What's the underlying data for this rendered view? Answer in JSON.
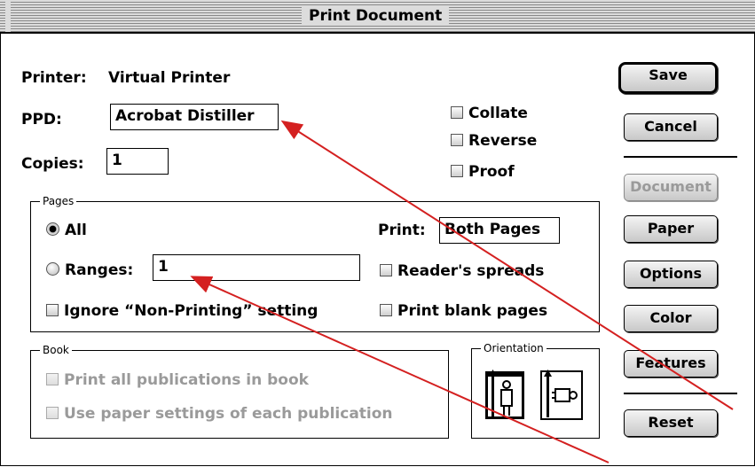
{
  "window": {
    "title": "Print Document"
  },
  "printer": {
    "label": "Printer:",
    "value": "Virtual Printer"
  },
  "ppd": {
    "label": "PPD:",
    "value": "Acrobat Distiller"
  },
  "copies": {
    "label": "Copies:",
    "value": "1"
  },
  "options": {
    "collate": "Collate",
    "reverse": "Reverse",
    "proof": "Proof"
  },
  "pages": {
    "title": "Pages",
    "all": "All",
    "ranges": "Ranges:",
    "ranges_value": "1",
    "print_label": "Print:",
    "print_value": "Both Pages",
    "readers_spreads": "Reader's spreads",
    "ignore_nonprinting": "Ignore “Non-Printing” setting",
    "print_blank": "Print blank pages"
  },
  "book": {
    "title": "Book",
    "print_all": "Print all publications in book",
    "use_paper": "Use paper settings of each publication"
  },
  "orientation": {
    "title": "Orientation"
  },
  "buttons": {
    "save": "Save",
    "cancel": "Cancel",
    "document": "Document",
    "paper": "Paper",
    "options": "Options",
    "color": "Color",
    "features": "Features",
    "reset": "Reset"
  },
  "colors": {
    "annotation_arrow": "#d42020",
    "disabled_text": "#9a9a9a"
  }
}
